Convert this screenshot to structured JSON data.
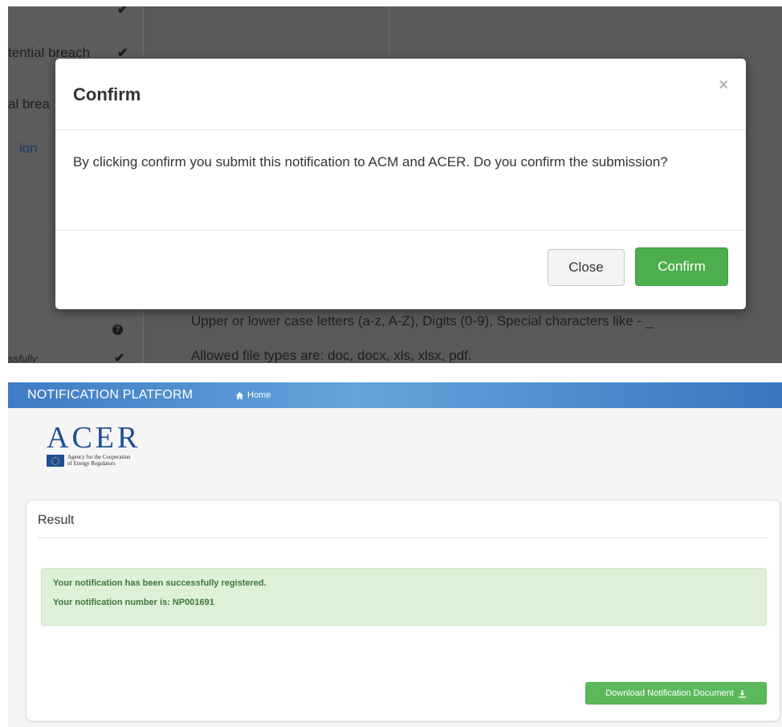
{
  "modal_screenshot": {
    "background": {
      "sidebar_items": [
        {
          "text": "tential breach"
        },
        {
          "text": "al brea"
        },
        {
          "text": "ion"
        },
        {
          "text": "ssfully"
        }
      ],
      "main_lines": [
        "Upper or lower case letters (a-z, A-Z), Digits (0-9), Special characters like - _",
        "Allowed file types are: doc, docx, xls, xlsx, pdf."
      ]
    },
    "modal": {
      "title": "Confirm",
      "close_symbol": "×",
      "body": "By clicking confirm you submit this notification to ACM and ACER. Do you confirm the submission?",
      "close_button": "Close",
      "confirm_button": "Confirm",
      "colors": {
        "confirm": "#4cae4c",
        "close": "#f3f3f3"
      }
    }
  },
  "result_page": {
    "navbar": {
      "brand": "NOTIFICATION PLATFORM",
      "home_link": "Home",
      "home_icon": "home-icon"
    },
    "logo": {
      "wordmark": "ACER",
      "caption_line1": "Agency for the Cooperation",
      "caption_line2": "of Energy Regulators"
    },
    "result": {
      "title": "Result",
      "success_line1": "Your notification has been successfully registered.",
      "success_line2": "Your notification number is: NP001691",
      "download_button": "Download Notification Document",
      "download_icon": "download-icon",
      "colors": {
        "alert_bg": "#dff0d8",
        "alert_text": "#3c763d",
        "button": "#5cb85c"
      }
    }
  }
}
